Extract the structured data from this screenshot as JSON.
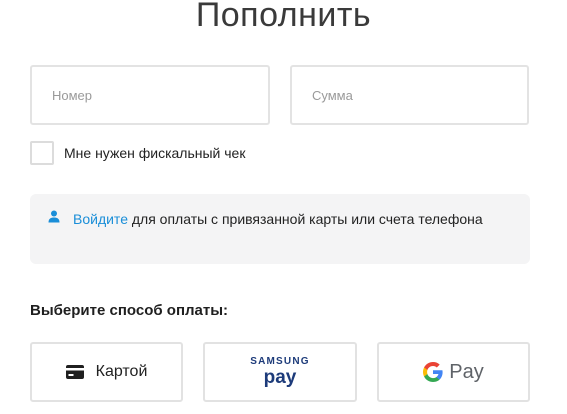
{
  "title": "Пополнить",
  "fields": {
    "number_placeholder": "Номер",
    "amount_placeholder": "Сумма"
  },
  "fiscal": {
    "label": "Мне нужен фискальный чек",
    "checked": false
  },
  "notice": {
    "link_label": "Войдите",
    "text": " для оплаты с привязанной карты или счета телефона"
  },
  "payment": {
    "heading": "Выберите способ оплаты:",
    "card_label": "Картой",
    "samsung_top": "SAMSUNG",
    "samsung_bottom": "pay",
    "google_label": "Pay"
  },
  "icons": {
    "user": "user-icon",
    "card": "credit-card-icon",
    "google": "google-g-icon"
  },
  "colors": {
    "link": "#1a8ed8",
    "samsung_brand": "#1d3b7a",
    "border": "#e2e2e2",
    "notice_bg": "#f4f4f5"
  }
}
